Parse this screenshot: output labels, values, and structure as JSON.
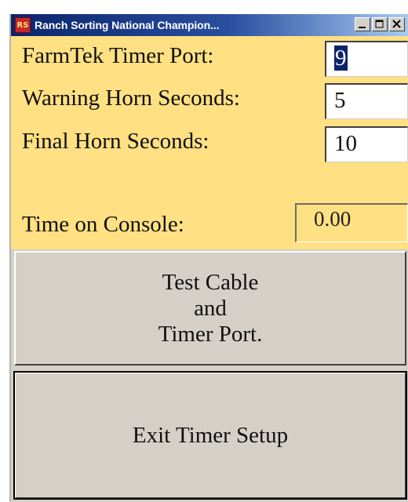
{
  "window": {
    "title": "Ranch Sorting National Champion...",
    "app_icon_glyph": "RS"
  },
  "colors": {
    "panel": "#ffe083",
    "titlebar": "#0a246a",
    "button_face": "#d4d0c8"
  },
  "fields": {
    "timer_port": {
      "label": "FarmTek Timer Port:",
      "value": "9"
    },
    "warning_horn": {
      "label": "Warning Horn Seconds:",
      "value": "5"
    },
    "final_horn": {
      "label": "Final Horn Seconds:",
      "value": "10"
    },
    "console_time": {
      "label": "Time on Console:",
      "value": "0.00"
    }
  },
  "buttons": {
    "test_cable": {
      "line1": "Test Cable",
      "line2": "and",
      "line3": "Timer Port."
    },
    "exit_setup": {
      "label": "Exit Timer Setup"
    }
  }
}
